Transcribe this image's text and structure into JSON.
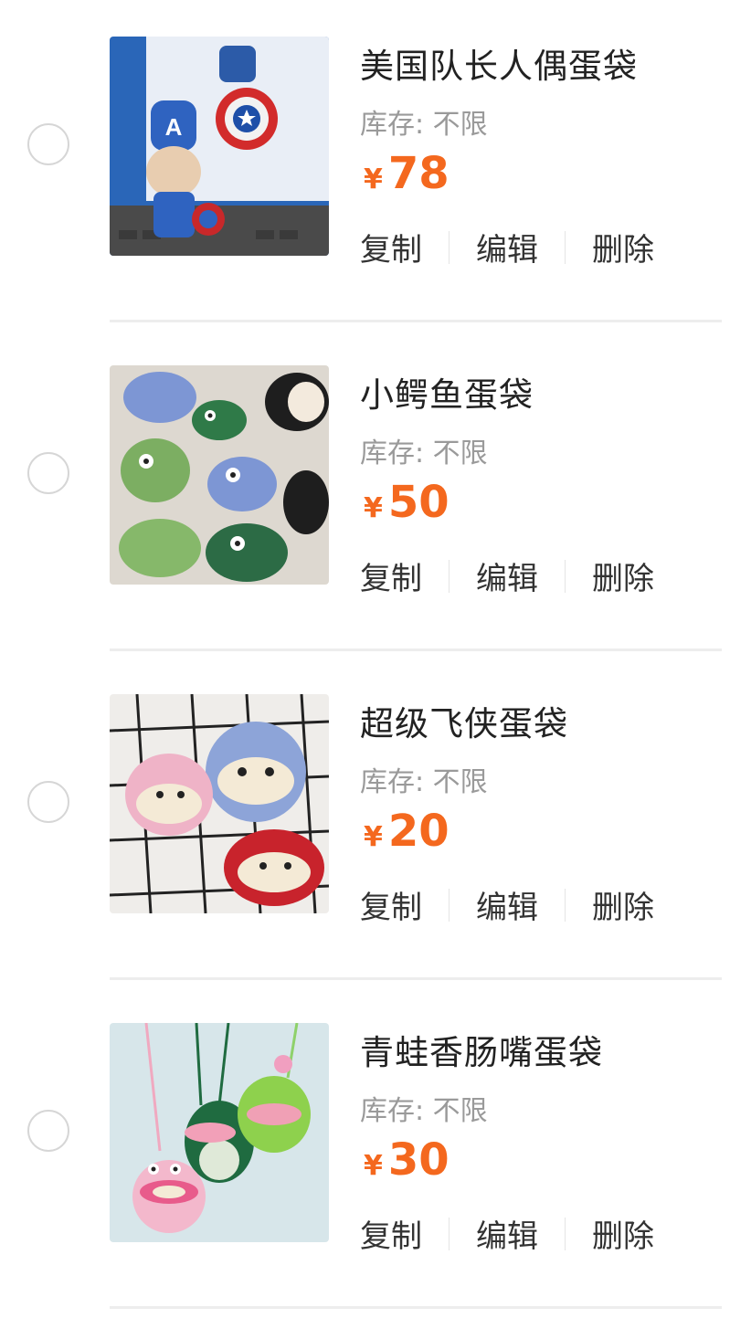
{
  "product_list": {
    "stock_label": "库存:",
    "currency_symbol": "¥",
    "actions": {
      "copy": "复制",
      "edit": "编辑",
      "delete": "删除"
    },
    "items": [
      {
        "title": "美国队长人偶蛋袋",
        "stock_value": "不限",
        "price": "78",
        "image_icon": "captain-america-crochet-doll-image"
      },
      {
        "title": "小鳄鱼蛋袋",
        "stock_value": "不限",
        "price": "50",
        "image_icon": "crocodile-crochet-bags-image"
      },
      {
        "title": "超级飞侠蛋袋",
        "stock_value": "不限",
        "price": "20",
        "image_icon": "super-wings-crochet-bags-image"
      },
      {
        "title": "青蛙香肠嘴蛋袋",
        "stock_value": "不限",
        "price": "30",
        "image_icon": "frog-sausage-mouth-crochet-bags-image"
      }
    ]
  },
  "colors": {
    "price": "#f4681e",
    "divider": "#ededed",
    "radio_border": "#d6d6d6",
    "muted_text": "#9a9a9a"
  }
}
